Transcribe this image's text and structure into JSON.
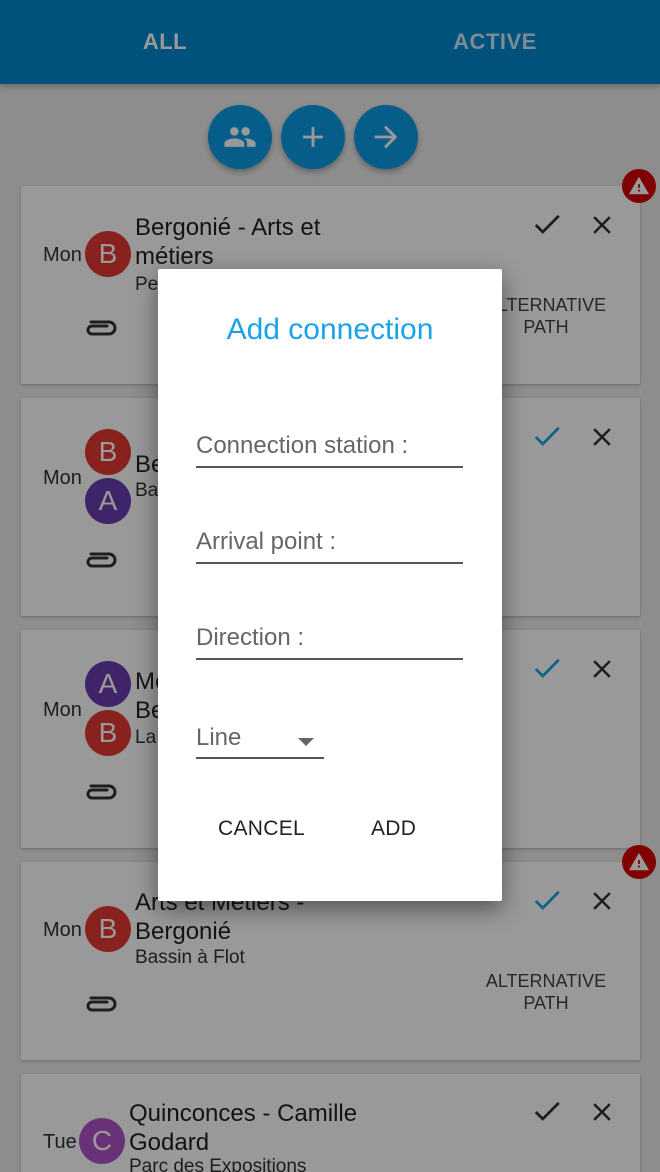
{
  "tabs": {
    "all": "ALL",
    "active": "ACTIVE"
  },
  "fabs": [
    "people-icon",
    "plus-icon",
    "arrow-right-icon"
  ],
  "cards": [
    {
      "day": "Mon",
      "title_line1": "Bergonié - Arts et",
      "title_line2": "métiers",
      "sub": "Pe",
      "badges": [
        "B"
      ],
      "alt_line1": "ALTERNATIVE",
      "alt_line2": "PATH",
      "warning": true,
      "checked": false
    },
    {
      "day": "Mon",
      "title_line1": "Be",
      "sub": "Ba",
      "badges": [
        "B",
        "A"
      ],
      "checked": true
    },
    {
      "day": "Mon",
      "title_line1": "Mé",
      "title_line2": "Be",
      "sub": "La",
      "badges": [
        "A",
        "B"
      ],
      "checked": true
    },
    {
      "day": "Mon",
      "title_line1": "Arts et Métiers -",
      "title_line2": "Bergonié",
      "sub": "Bassin à Flot",
      "badges": [
        "B"
      ],
      "alt_line1": "ALTERNATIVE",
      "alt_line2": "PATH",
      "warning": true,
      "checked": true
    },
    {
      "day": "Tue",
      "title_line1": "Quinconces - Camille",
      "title_line2": "Godard",
      "sub": "Parc des Expositions",
      "badges": [
        "C"
      ],
      "checked": false
    }
  ],
  "dialog": {
    "title": "Add connection",
    "connection_station": "Connection station :",
    "arrival_point": "Arrival point :",
    "direction": "Direction :",
    "line": "Line",
    "cancel": "CANCEL",
    "add": "ADD"
  },
  "colors": {
    "primary": "#0288d1",
    "accent": "#1aa3e8",
    "badge_red": "#e53935",
    "badge_purple": "#6a3db0",
    "warning": "#d50000"
  }
}
